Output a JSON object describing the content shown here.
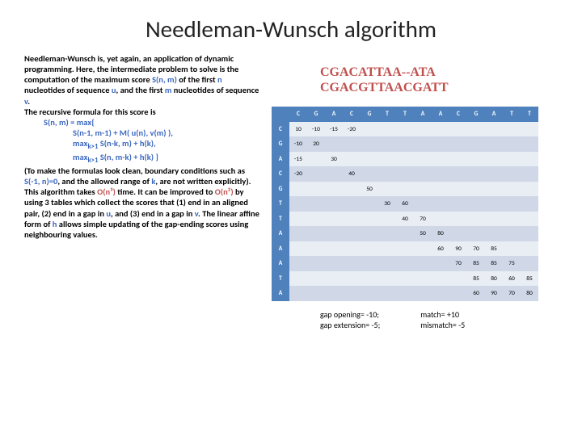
{
  "title": "Needleman-Wunsch algorithm",
  "left": {
    "para1a": "Needleman-Wunsch is, yet again, an application of dynamic programming. Here, the intermediate problem to solve is the computation of the maximum score ",
    "snm1": "S(n, m)",
    "para1b": " of the first ",
    "n1": "n",
    "para1c": " nucleotides of sequence ",
    "u1": "u",
    "para1d": ", and the first ",
    "m1": "m",
    "para1e": " nucleotides of sequence ",
    "v1": "v",
    "dot1": ".",
    "para2": "The recursive formula for this score is",
    "f1": "S(n, m) = max{",
    "f2": "S(n-1, m-1) + M( u(n), v(m) ),",
    "f3_a": "max",
    "f3_sub": "k>1",
    "f3_b": " S(n-k, m) + h(k),",
    "f4_a": "max",
    "f4_sub": "k>1",
    "f4_b": " S(n, m-k) + h(k) }",
    "para3a": "(To make the formulas look clean, boundary conditions such as ",
    "bc": "S(-1, n)=0",
    "para3b": ", and the allowed range of ",
    "kk": "k",
    "para3c": ", are not written explicitly).",
    "para4a": "This algorithm takes ",
    "on3": "O(n³)",
    "para4b": " time.  It can be improved to ",
    "on2": "O(n²)",
    "para4c": " by using 3 tables which collect the scores that (1) end in an aligned pair, (2) end in a gap in ",
    "u2": "u",
    "para4d": ", and (3) end in a gap in ",
    "v2": "v",
    "para4e": ".  The linear affine form of ",
    "hh": "h",
    "para4f": " allows simple updating of the gap-ending scores using neighbouring values."
  },
  "align1": "CGACATTAA--ATA",
  "align2": "CGACGTTAACGATT",
  "cols": [
    "C",
    "G",
    "A",
    "C",
    "G",
    "T",
    "T",
    "A",
    "A",
    "C",
    "G",
    "A",
    "T",
    "T"
  ],
  "rows": [
    "C",
    "G",
    "A",
    "C",
    "G",
    "T",
    "T",
    "A",
    "A",
    "A",
    "T",
    "A"
  ],
  "chart_data": {
    "type": "table",
    "title": "Needleman–Wunsch DP scoring matrix",
    "col_labels": [
      "C",
      "G",
      "A",
      "C",
      "G",
      "T",
      "T",
      "A",
      "A",
      "C",
      "G",
      "A",
      "T",
      "T"
    ],
    "row_labels": [
      "C",
      "G",
      "A",
      "C",
      "G",
      "T",
      "T",
      "A",
      "A",
      "A",
      "T",
      "A"
    ],
    "cells": {
      "C": {
        "C": 10,
        "G": -10,
        "A": -15,
        "C2": -20
      },
      "G": {
        "C": -10,
        "G": 20
      },
      "A": {
        "C": -15,
        "A": 30
      },
      "C2": {
        "C": -20,
        "C2": 40
      },
      "G2": {
        "G2": 50
      },
      "T": {
        "T": 30,
        "T2": 60
      },
      "T2": {
        "T": 40,
        "A": 70
      },
      "A2": {
        "A": 50,
        "A2": 80
      },
      "A3": {
        "A2": 60,
        "C": 90,
        "G": 70,
        "A3": 85
      },
      "A4": {
        "C": 70,
        "G": 85,
        "A3": 85,
        "T": 75
      },
      "T3": {
        "G": 85,
        "A3": 80,
        "T": 60,
        "T2": 85
      },
      "A5": {
        "A3": 60,
        "T": 90,
        "T2": 70,
        "end": 80
      }
    }
  },
  "c": {
    "0_0": "10",
    "0_1": "-10",
    "0_2": "-15",
    "0_3": "-20",
    "1_0": "-10",
    "1_1": "20",
    "2_0": "-15",
    "2_2": "30",
    "3_0": "-20",
    "3_3": "40",
    "4_4": "50",
    "5_5": "30",
    "5_6": "60",
    "6_6": "40",
    "6_7": "70",
    "7_7": "50",
    "7_8": "80",
    "8_8": "60",
    "8_9": "90",
    "8_10": "70",
    "8_11": "85",
    "9_9": "70",
    "9_10": "85",
    "9_11": "85",
    "9_12": "75",
    "10_10": "85",
    "10_11": "80",
    "10_12": "60",
    "10_13": "85",
    "11_10": "60",
    "11_11": "90",
    "11_12": "70",
    "11_13": "80"
  },
  "caption1": "gap opening= -10;\ngap extension= -5;",
  "caption2": "match= +10\nmismatch= -5"
}
